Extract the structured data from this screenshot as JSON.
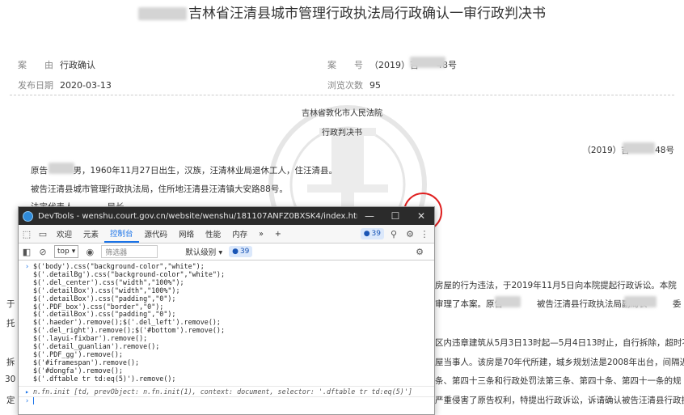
{
  "doc": {
    "title": "吉林省汪清县城市管理行政执法局行政确认一审行政判决书",
    "meta": {
      "cause_label": "案　　由",
      "cause_value": "行政确认",
      "case_no_label": "案　　号",
      "case_no_value": "（2019）吉　　48号",
      "pub_date_label": "发布日期",
      "pub_date_value": "2020-03-13",
      "views_label": "浏览次数",
      "views_value": "95"
    },
    "court": "吉林省敦化市人民法院",
    "doc_type": "行政判决书",
    "case_no_right": "（2019）吉　　　48号",
    "paragraphs": [
      "原告　　　男，1960年11月27日出生，汉族，汪清林业局退休工人，住汪清县。",
      "被告汪清县城市管理行政执法局，住所地汪清县汪清镇大安路88号。",
      "法定代表人　　　　局长。"
    ],
    "right_fragments": [
      "房屋的行为违法，于2019年11月5日向本院提起行政诉讼。本院",
      "审理了本案。原告　　　　被告汪清县行政执法局副局长　　　委",
      "区内违章建筑从5月3日13时起—5月4日13时止，自行拆除，超时不",
      "屋当事人。该房是70年代所建，城乡规划法是2008年出台，间隔近",
      "条、第四十三条和行政处罚法第三条、第四十条、第四十一条的规",
      "严重侵害了原告权利，特提出行政诉讼，诉请确认被告汪清县行政执"
    ],
    "left_fragments": [
      "于",
      "托",
      "拆",
      "30",
      "定"
    ]
  },
  "devtools": {
    "title": "DevTools - wenshu.court.gov.cn/website/wenshu/181107ANFZ0BXSK4/index.html?docId=5MmTp2LPNj...",
    "window_buttons": {
      "minimize": "—",
      "maximize": "☐",
      "close": "✕"
    },
    "tabs": [
      "欢迎",
      "元素",
      "控制台",
      "源代码",
      "网络",
      "性能",
      "内存"
    ],
    "active_tab": "控制台",
    "more_tabs": "»",
    "add_tab": "+",
    "issues_count": "39",
    "toolbar": {
      "context": "top",
      "filter_placeholder": "筛选器",
      "level": "默认级别",
      "issues": "39"
    },
    "console_lines": [
      "$('body').css(\"background-color\",\"white\");",
      "$('.detailBg').css(\"background-color\",\"white\");",
      "$('.del_center').css(\"width\",\"100%\");",
      "$('.detailBox').css(\"width\",\"100%\");",
      "$('.detailBox').css(\"padding\",\"0\");",
      "$('.PDF_box').css(\"border\",\"0\");",
      "$('.detailBox').css(\"padding\",\"0\");",
      "$('.haeder').remove();$('.del_left').remove();",
      "$('.del_right').remove();$('#bottom').remove();",
      "$('.layui-fixbar').remove();",
      "$('.detail_guanlian').remove();",
      "$('.PDF_gg').remove();",
      "$('#iframespan').remove();",
      "$('#dongfa').remove();",
      "$('.dftable tr td:eq(5)').remove();"
    ],
    "output": "n.fn.init [td, prevObject: n.fn.init(1), context: document, selector: '.dftable tr td:eq(5)']"
  }
}
